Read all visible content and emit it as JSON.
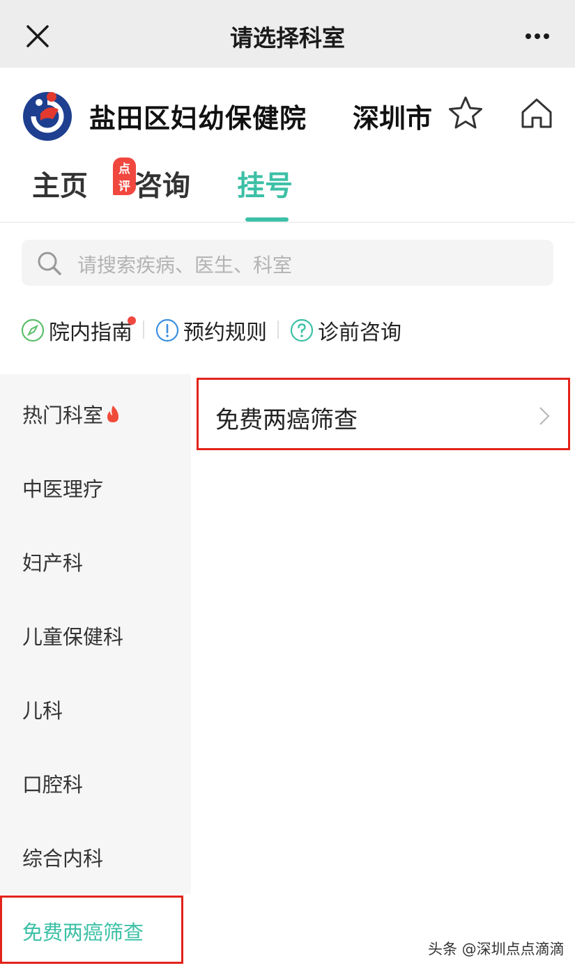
{
  "navbar": {
    "title": "请选择科室"
  },
  "hospital": {
    "name": "盐田区妇幼保健院",
    "city": "深圳市"
  },
  "tabs": [
    {
      "label": "主页",
      "badge": "点评"
    },
    {
      "label": "咨询"
    },
    {
      "label": "挂号",
      "active": true
    }
  ],
  "search": {
    "placeholder": "请搜索疾病、医生、科室"
  },
  "quick_links": [
    {
      "label": "院内指南",
      "icon": "compass-icon",
      "has_dot": true
    },
    {
      "label": "预约规则",
      "icon": "exclamation-circle-icon"
    },
    {
      "label": "诊前咨询",
      "icon": "question-circle-icon"
    }
  ],
  "departments": [
    {
      "label": "热门科室",
      "icon": "fire-icon"
    },
    {
      "label": "中医理疗"
    },
    {
      "label": "妇产科"
    },
    {
      "label": "儿童保健科"
    },
    {
      "label": "儿科"
    },
    {
      "label": "口腔科"
    },
    {
      "label": "综合内科"
    },
    {
      "label": "免费两癌筛查",
      "active": true
    }
  ],
  "sub_departments": [
    {
      "label": "免费两癌筛查"
    }
  ],
  "watermark": "头条 @深圳点点滴滴",
  "colors": {
    "accent": "#3cc0a6",
    "highlight_box": "#e2231a",
    "badge": "#f0473f"
  }
}
